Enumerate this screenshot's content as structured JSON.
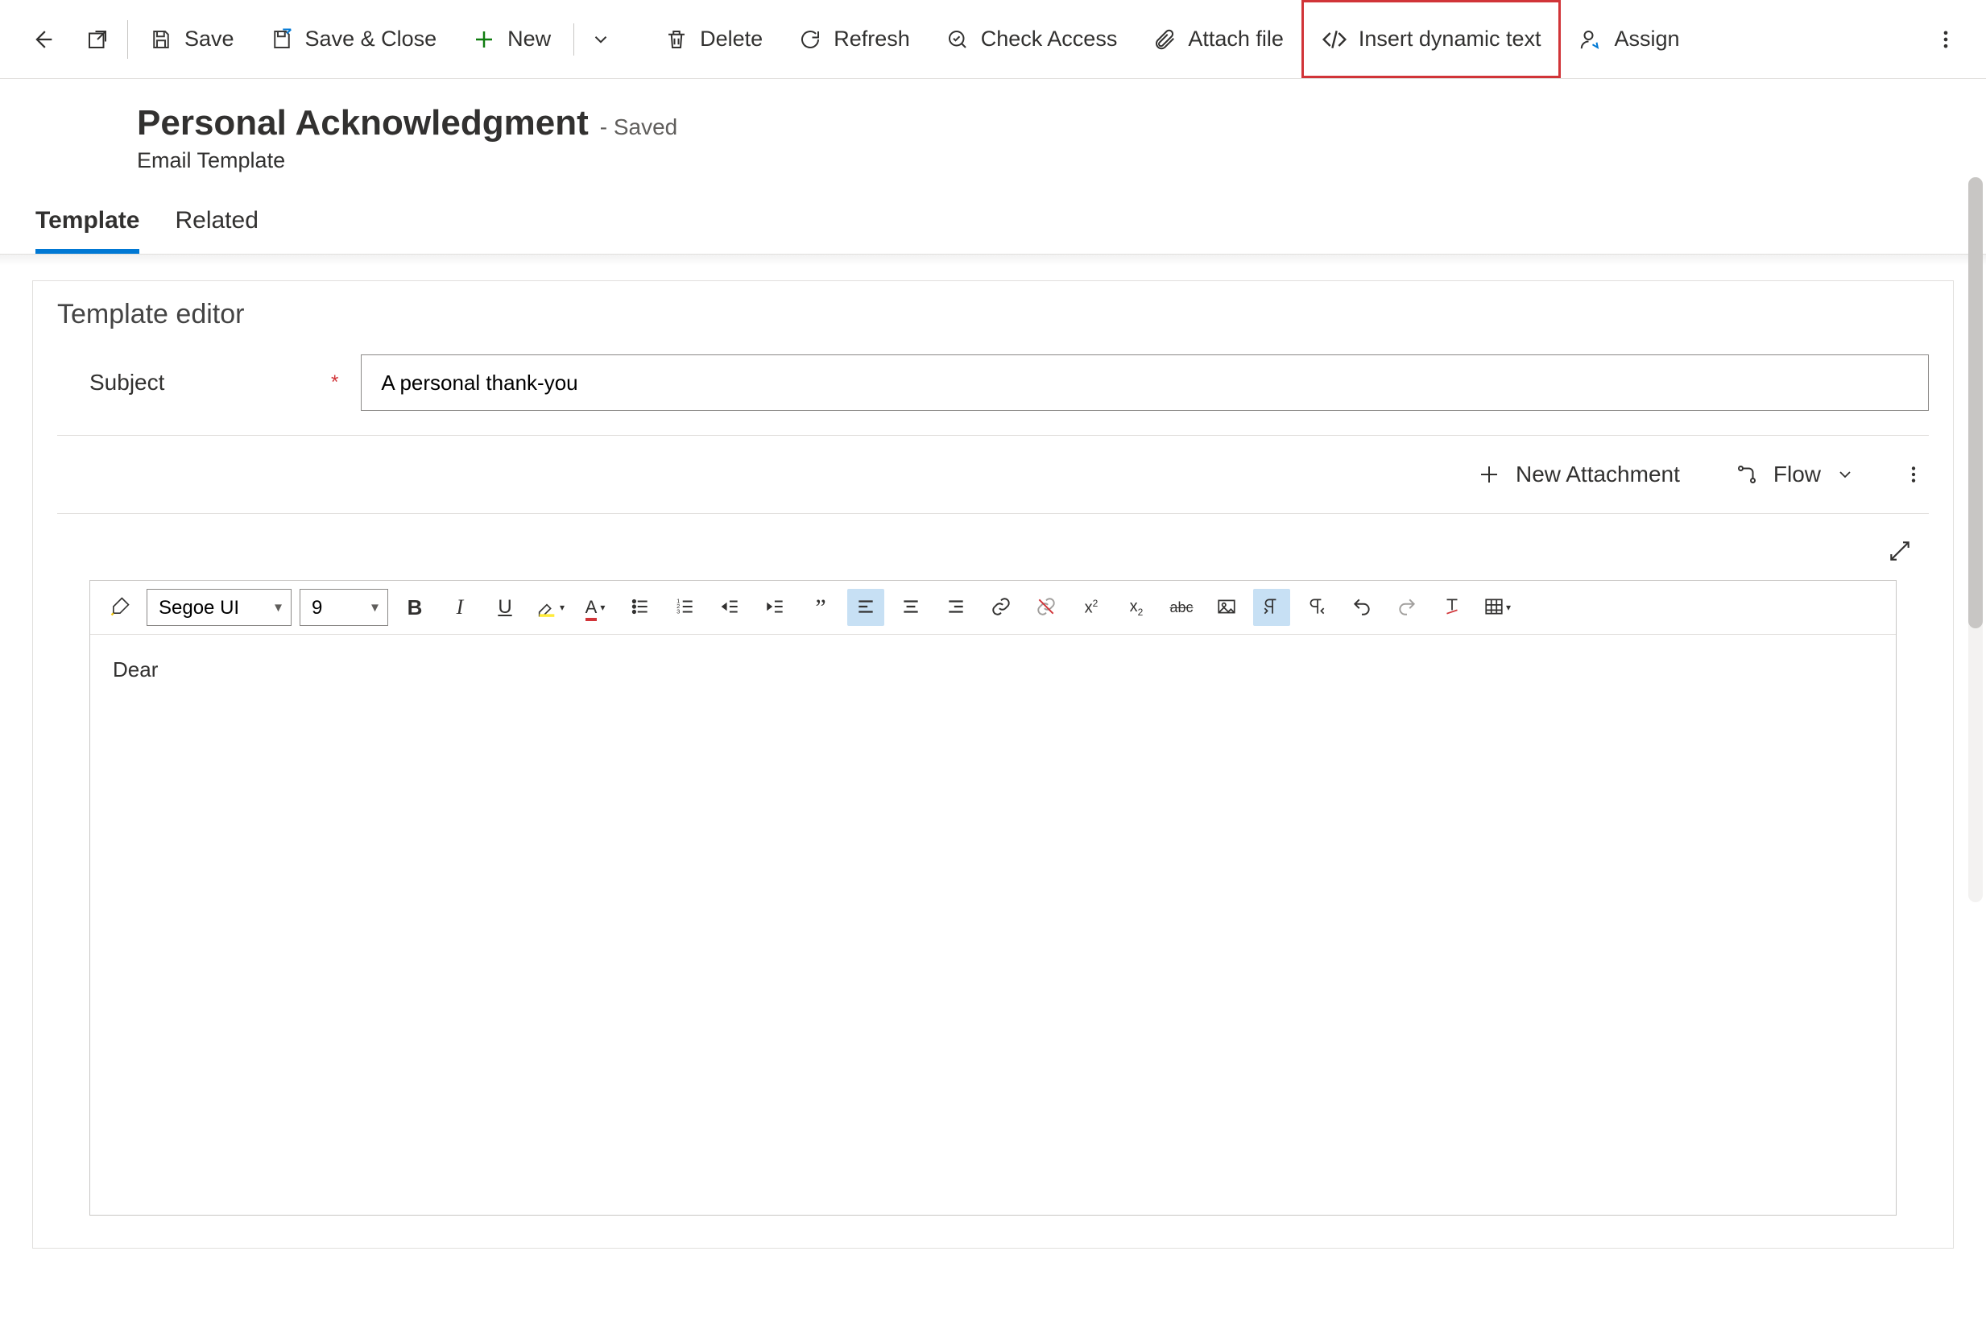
{
  "commandbar": {
    "save": "Save",
    "save_close": "Save & Close",
    "new": "New",
    "delete": "Delete",
    "refresh": "Refresh",
    "check_access": "Check Access",
    "attach_file": "Attach file",
    "insert_dynamic_text": "Insert dynamic text",
    "assign": "Assign"
  },
  "record": {
    "title": "Personal Acknowledgment",
    "status": "- Saved",
    "entity": "Email Template"
  },
  "tabs": {
    "template": "Template",
    "related": "Related"
  },
  "editor": {
    "section_title": "Template editor",
    "subject_label": "Subject",
    "subject_value": "A personal thank-you",
    "new_attachment": "New Attachment",
    "flow": "Flow",
    "font_name": "Segoe UI",
    "font_size": "9",
    "body_text": "Dear"
  }
}
